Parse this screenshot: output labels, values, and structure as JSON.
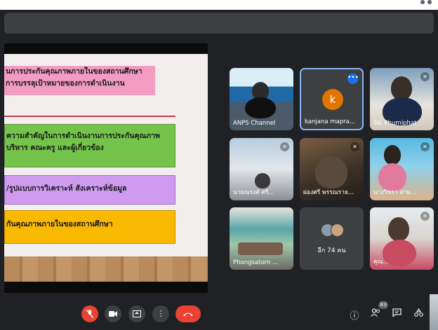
{
  "presentation": {
    "line1": "นการประกันคุณภาพภายในของสถานศึกษา",
    "line2": "การบรรลุเป้าหมายของการดำเนินงาน",
    "line3": "ความสำคัญในการดำเนินงานการประกันคุณภาพ",
    "line4": "บริหาร คณะครู และผู้เกี่ยวข้อง",
    "line5": "/รูปแบบการวิเคราะห์ สังเคราะห์ข้อมูล",
    "line6": "กันคุณภาพภายในของสถานศึกษา"
  },
  "participants": [
    {
      "name": "ANPS Channel"
    },
    {
      "name": "kanjana mapra...",
      "avatar_letter": "k"
    },
    {
      "name": "SV. Phumiphat"
    },
    {
      "name": "นายณรงค์ ศรี..."
    },
    {
      "name": "ผ่องศรี พรรณราย..."
    },
    {
      "name": "นางวิชรา สาม..."
    },
    {
      "name": "Phongsatorn ..."
    },
    {
      "name": "อีก 74 คน"
    },
    {
      "name": "คุณ..."
    }
  ],
  "toolbar": {
    "mic_icon": "mic-off-icon",
    "camera_icon": "camera-icon",
    "present_icon": "present-icon",
    "more_icon": "more-vert-icon",
    "end_icon": "end-call-icon",
    "people_count": "83"
  },
  "colors": {
    "background": "#202124",
    "tile": "#3c4043",
    "danger": "#ea4335",
    "accent": "#1a73e8"
  }
}
